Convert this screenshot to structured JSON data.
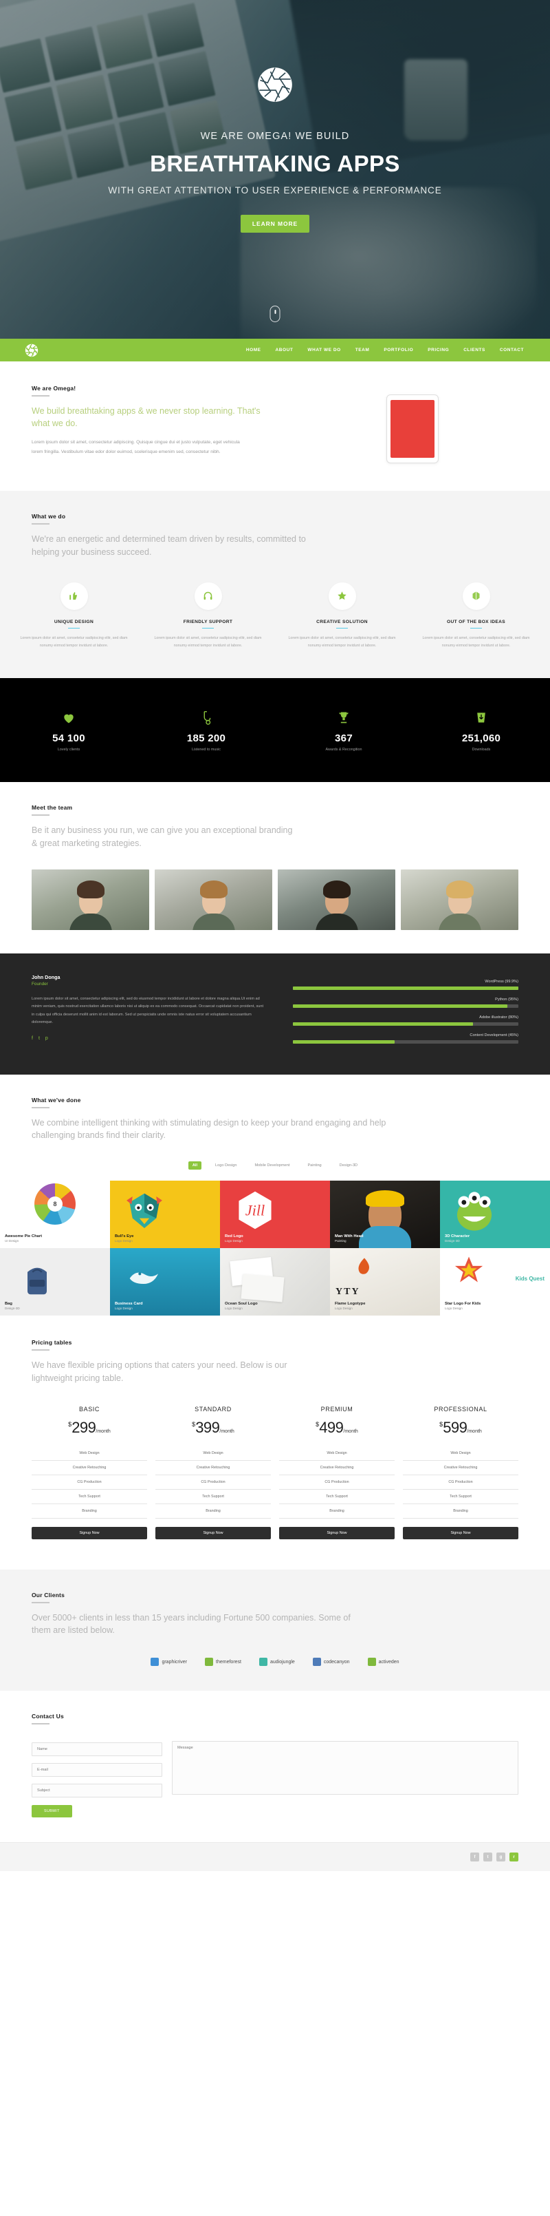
{
  "hero": {
    "logo_icon": "shutter-aperture-icon",
    "kicker": "WE ARE OMEGA! WE BUILD",
    "title": "BREATHTAKING APPS",
    "subtitle": "WITH GREAT ATTENTION TO USER EXPERIENCE & PERFORMANCE",
    "cta": "LEARN MORE",
    "scroll_indicator": "scroll-down-mouse-icon"
  },
  "nav": {
    "logo_icon": "shutter-aperture-icon",
    "brand_color": "#8cc63e",
    "items": [
      {
        "label": "HOME"
      },
      {
        "label": "ABOUT"
      },
      {
        "label": "WHAT WE DO"
      },
      {
        "label": "TEAM"
      },
      {
        "label": "PORTFOLIO"
      },
      {
        "label": "PRICING"
      },
      {
        "label": "CLIENTS"
      },
      {
        "label": "CONTACT"
      }
    ]
  },
  "about": {
    "eyebrow": "We are Omega!",
    "lead": "We build breathtaking apps & we never stop learning. That's what we do.",
    "body": "Lorem ipsum dolor sit amet, consectetur adipiscing. Quisque cingue dui et justo vulputate, eget vehicula lorem fringilla. Vestibulum vitae edor dolor euimod, scelerisque emenim sed, consectetur nibh.",
    "device_icon": "tablet-device-icon"
  },
  "whatwedo": {
    "eyebrow": "What we do",
    "lead": "We're an energetic and determined team driven by results, committed to helping your business succeed.",
    "features": [
      {
        "icon": "thumbs-up-icon",
        "title": "UNIQUE DESIGN",
        "text": "Lorem ipsum dolor sit amet, consetetur sadipiscing elitr, sed diam nonumy eirmod tempor invidunt ut labore."
      },
      {
        "icon": "headphones-icon",
        "title": "FRIENDLY SUPPORT",
        "text": "Lorem ipsum dolor sit amet, consetetur sadipiscing elitr, sed diam nonumy eirmod tempor invidunt ut labore."
      },
      {
        "icon": "star-icon",
        "title": "CREATIVE SOLUTION",
        "text": "Lorem ipsum dolor sit amet, consetetur sadipiscing elitr, sed diam nonumy eirmod tempor invidunt ut labore."
      },
      {
        "icon": "leaf-sprout-icon",
        "title": "OUT OF THE BOX IDEAS",
        "text": "Lorem ipsum dolor sit amet, consetetur sadipiscing elitr, sed diam nonumy eirmod tempor invidunt ut labore."
      }
    ]
  },
  "counters": {
    "accent": "#8cc63e",
    "items": [
      {
        "icon": "heart-icon",
        "value": "54 100",
        "label": "Lovely clients"
      },
      {
        "icon": "saxophone-icon",
        "value": "185 200",
        "label": "Listened to music"
      },
      {
        "icon": "trophy-icon",
        "value": "367",
        "label": "Awards & Recongition"
      },
      {
        "icon": "download-bag-icon",
        "value": "251,060",
        "label": "Downloads"
      }
    ]
  },
  "team": {
    "eyebrow": "Meet the team",
    "lead": "Be it any business you run, we can give you an exceptional branding & great marketing strategies.",
    "members": [
      {
        "photo": "team-member-photo-1"
      },
      {
        "photo": "team-member-photo-2"
      },
      {
        "photo": "team-member-photo-3"
      },
      {
        "photo": "team-member-photo-4"
      }
    ]
  },
  "testimonial": {
    "name": "John Donga",
    "role": "Founder",
    "text": "Lorem ipsum dolor sit amet, consectetur adipiscing elit, sed do eiusmod tempor incididunt ut labore et dolore magna aliqua.Ut enim ad minim veniam, quis nostrud exercitation ullamco laboris nisi ut aliquip ex ea commodo consequat. Occaecat cupidatat non proident, sunt in culpa qui officia deserunt mollit anim id est laborum. Sed ut perspiciatis unde omnis iste natus error sit voluptatem accusantium doloremque.",
    "social": [
      {
        "icon": "facebook-icon",
        "glyph": "f"
      },
      {
        "icon": "twitter-icon",
        "glyph": "t"
      },
      {
        "icon": "pinterest-icon",
        "glyph": "p"
      }
    ],
    "skills": [
      {
        "label": "WordPress (99.9%)",
        "value": 99.9
      },
      {
        "label": "Python (95%)",
        "value": 95
      },
      {
        "label": "Adobe illustrator (80%)",
        "value": 80
      },
      {
        "label": "Content Development (45%)",
        "value": 45
      }
    ]
  },
  "portfolio": {
    "eyebrow": "What we've done",
    "lead": "We combine intelligent thinking with stimulating design to keep your brand engaging and help challenging brands find their clarity.",
    "filters": [
      {
        "label": "All",
        "active": true
      },
      {
        "label": "Logo Design",
        "active": false
      },
      {
        "label": "Mobile Development",
        "active": false
      },
      {
        "label": "Painting",
        "active": false
      },
      {
        "label": "Design-3D",
        "active": false
      }
    ],
    "items": [
      {
        "title": "Awesome Pie Chart",
        "subtitle": "UI Design",
        "style": "pbg-white",
        "art": "pie-chart",
        "dark_text": false
      },
      {
        "title": "Bull's Eye",
        "subtitle": "Logo Design",
        "style": "pbg-yellow",
        "art": "mascot-bull",
        "dark_text": false
      },
      {
        "title": "Red Logo",
        "subtitle": "Logo Design",
        "style": "pbg-red",
        "art": "hex-logo",
        "dark_text": true
      },
      {
        "title": "Man With Head",
        "subtitle": "Painting",
        "style": "pbg-photo1",
        "art": "portrait",
        "dark_text": true
      },
      {
        "title": "3D Character",
        "subtitle": "Design-3D",
        "style": "pbg-teal",
        "art": "monster",
        "dark_text": true
      },
      {
        "title": "Bag",
        "subtitle": "Design-3D",
        "style": "pbg-grey",
        "art": "backpack",
        "dark_text": false
      },
      {
        "title": "Business Card",
        "subtitle": "Logo Design",
        "style": "pbg-ocean",
        "art": "ocean-souls",
        "dark_text": true
      },
      {
        "title": "Ocean Soul Logo",
        "subtitle": "Logo Design",
        "style": "pbg-card",
        "art": "biz-card",
        "dark_text": false
      },
      {
        "title": "Flame Logotype",
        "subtitle": "Logo Design",
        "style": "pbg-paper",
        "art": "newspaper",
        "dark_text": false
      },
      {
        "title": "Star Logo For Kids",
        "subtitle": "Logo Design",
        "style": "pbg-kids",
        "art": "kids-quest",
        "dark_text": false
      }
    ]
  },
  "pricing": {
    "eyebrow": "Pricing tables",
    "lead": "We have flexible pricing options that caters your need. Below is our lightweight pricing table.",
    "features": [
      "Web Design",
      "Creative Retouching",
      "CG Production",
      "Tech Support",
      "Branding"
    ],
    "cta": "Signup Now",
    "plans": [
      {
        "name": "BASIC",
        "currency": "$",
        "amount": "299",
        "period": "/month"
      },
      {
        "name": "STANDARD",
        "currency": "$",
        "amount": "399",
        "period": "/month"
      },
      {
        "name": "PREMIUM",
        "currency": "$",
        "amount": "499",
        "period": "/month"
      },
      {
        "name": "PROFESSIONAL",
        "currency": "$",
        "amount": "599",
        "period": "/month"
      }
    ]
  },
  "clients": {
    "eyebrow": "Our Clients",
    "lead": "Over 5000+ clients in less than 15 years including Fortune 500 companies. Some of them are listed below.",
    "logos": [
      {
        "name": "graphicriver",
        "color": "#3e8fd6"
      },
      {
        "name": "themeforest",
        "color": "#7fb93c"
      },
      {
        "name": "audiojungle",
        "color": "#3fb7a5"
      },
      {
        "name": "codecanyon",
        "color": "#4e7bb8"
      },
      {
        "name": "activeden",
        "color": "#7fb93c"
      }
    ]
  },
  "contact": {
    "eyebrow": "Contact Us",
    "fields": {
      "name_placeholder": "Name",
      "email_placeholder": "E-mail",
      "subject_placeholder": "Subject",
      "message_placeholder": "Message"
    },
    "submit": "SUBMIT"
  },
  "footer": {
    "social": [
      {
        "icon": "facebook-icon",
        "glyph": "f",
        "accent": false
      },
      {
        "icon": "twitter-icon",
        "glyph": "t",
        "accent": false
      },
      {
        "icon": "google-plus-icon",
        "glyph": "g",
        "accent": false
      },
      {
        "icon": "rss-icon",
        "glyph": "r",
        "accent": true
      }
    ]
  }
}
